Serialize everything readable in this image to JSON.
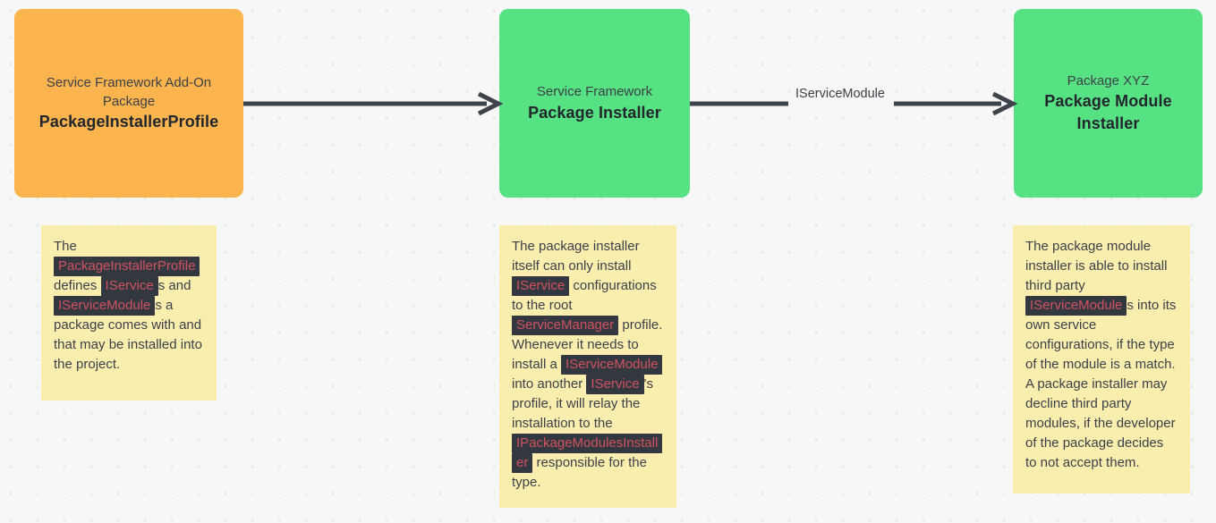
{
  "canvas": {
    "background_color": "#f7f7f8",
    "dot_color": "#dfe1e6"
  },
  "nodes": [
    {
      "id": "package-installer-profile",
      "subtitle": "Service Framework Add-On Package",
      "title": "PackageInstallerProfile",
      "color": "#fbb44e"
    },
    {
      "id": "package-installer",
      "subtitle": "Service Framework",
      "title": "Package Installer",
      "color": "#56e283"
    },
    {
      "id": "package-module-installer",
      "subtitle": "Package XYZ",
      "title": "Package Module Installer",
      "color": "#56e283"
    }
  ],
  "edges": [
    {
      "id": "edge-profile-to-installer",
      "label": "",
      "color": "#3f444c"
    },
    {
      "id": "edge-installer-to-module-installer",
      "label": "IServiceModule",
      "color": "#3f444c"
    }
  ],
  "notes": {
    "left": {
      "id": "note-package-installer-profile",
      "parts": [
        {
          "type": "text",
          "value": "The "
        },
        {
          "type": "code",
          "value": "PackageInstallerProfile"
        },
        {
          "type": "text",
          "value": " defines "
        },
        {
          "type": "code",
          "value": "IService"
        },
        {
          "type": "text",
          "value": "s and "
        },
        {
          "type": "code",
          "value": "IServiceModule"
        },
        {
          "type": "text",
          "value": "s a package comes with and that may be installed into the project."
        }
      ]
    },
    "middle": {
      "id": "note-package-installer",
      "parts": [
        {
          "type": "text",
          "value": "The package installer itself can only install "
        },
        {
          "type": "code",
          "value": "IService"
        },
        {
          "type": "text",
          "value": " configurations to the root "
        },
        {
          "type": "code",
          "value": "ServiceManager"
        },
        {
          "type": "text",
          "value": " profile. Whenever it needs to install a "
        },
        {
          "type": "code",
          "value": "IServiceModule"
        },
        {
          "type": "text",
          "value": " into another "
        },
        {
          "type": "code",
          "value": "IService"
        },
        {
          "type": "text",
          "value": "'s profile, it will relay the installation to the "
        },
        {
          "type": "code",
          "value": "IPackageModulesInstaller"
        },
        {
          "type": "text",
          "value": " responsible for the type."
        }
      ]
    },
    "right": {
      "id": "note-package-module-installer",
      "parts": [
        {
          "type": "text",
          "value": "The package module installer is able to install third party "
        },
        {
          "type": "code",
          "value": "IServiceModule"
        },
        {
          "type": "text",
          "value": "s into its own service configurations, if the type of the module is a match. A package installer may decline third party modules, if the developer of the package decides to not accept them."
        }
      ]
    }
  },
  "colors": {
    "node_orange": "#fbb44e",
    "node_green": "#56e283",
    "note_yellow": "#faeeaf",
    "code_background": "#333840",
    "code_text": "#d0525f",
    "arrow": "#3f444c",
    "text": "#3b4049"
  }
}
